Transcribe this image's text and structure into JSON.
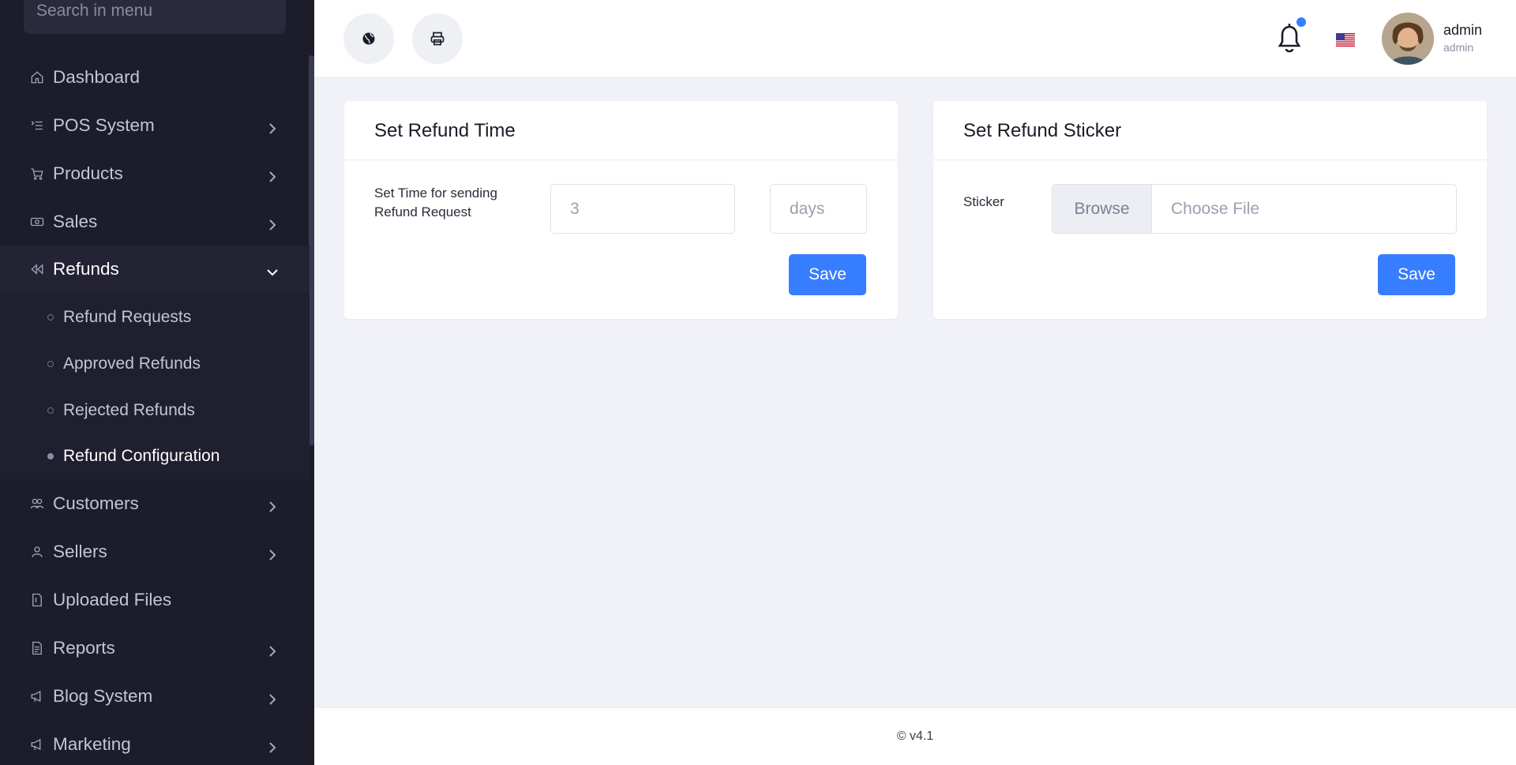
{
  "sidebar": {
    "search_placeholder": "Search in menu",
    "items": [
      {
        "label": "Dashboard",
        "icon": "home-icon"
      },
      {
        "label": "POS System",
        "icon": "list-icon"
      },
      {
        "label": "Products",
        "icon": "cart-icon"
      },
      {
        "label": "Sales",
        "icon": "money-icon"
      },
      {
        "label": "Refunds",
        "icon": "refund-icon"
      },
      {
        "label": "Customers",
        "icon": "users-icon"
      },
      {
        "label": "Sellers",
        "icon": "user-icon"
      },
      {
        "label": "Uploaded Files",
        "icon": "file-icon"
      },
      {
        "label": "Reports",
        "icon": "report-icon"
      },
      {
        "label": "Blog System",
        "icon": "megaphone-icon"
      },
      {
        "label": "Marketing",
        "icon": "megaphone-icon"
      }
    ],
    "refunds_submenu": [
      {
        "label": "Refund Requests"
      },
      {
        "label": "Approved Refunds"
      },
      {
        "label": "Rejected Refunds"
      },
      {
        "label": "Refund Configuration"
      }
    ]
  },
  "header": {
    "user_name": "admin",
    "user_role": "admin"
  },
  "refund_time_card": {
    "title": "Set Refund Time",
    "label": "Set Time for sending Refund Request",
    "value": "3",
    "unit": "days",
    "save": "Save"
  },
  "refund_sticker_card": {
    "title": "Set Refund Sticker",
    "label": "Sticker",
    "browse": "Browse",
    "choose": "Choose File",
    "save": "Save"
  },
  "footer": {
    "version": "© v4.1"
  },
  "colors": {
    "sidebar_bg": "#1c1c2b",
    "accent": "#377dff",
    "page_bg": "#f1f2f7"
  }
}
